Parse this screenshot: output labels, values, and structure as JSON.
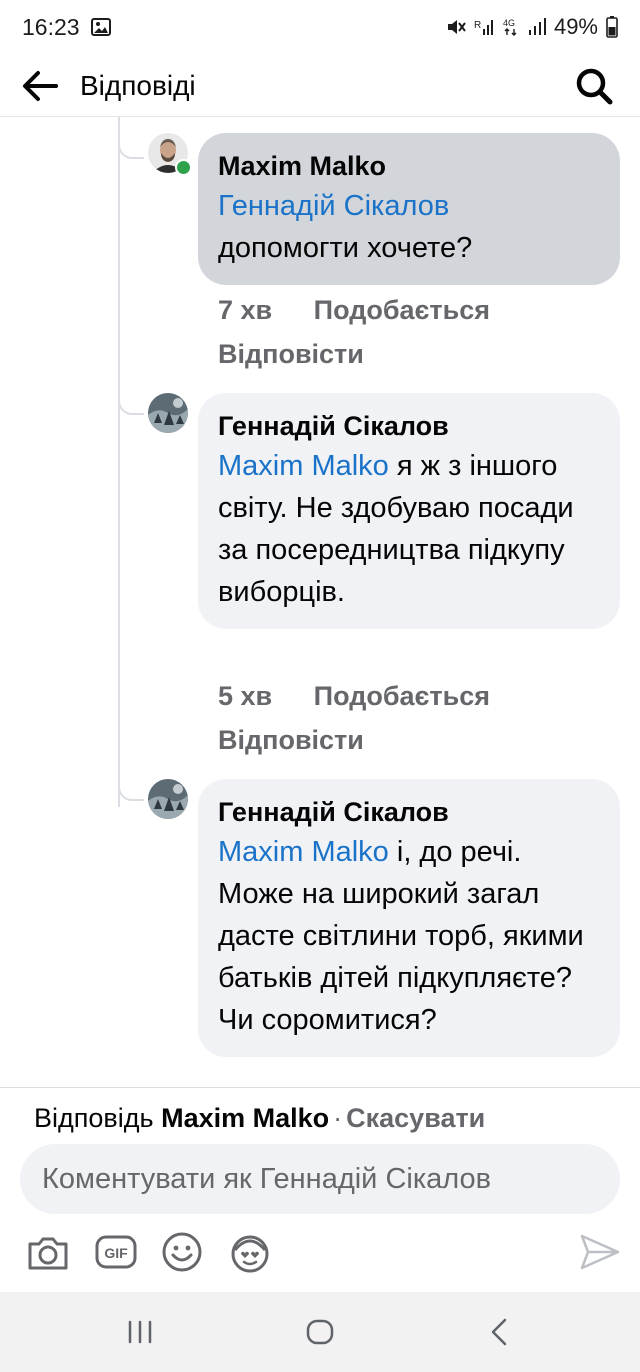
{
  "status_bar": {
    "time": "16:23",
    "battery": "49%"
  },
  "header": {
    "title": "Відповіді"
  },
  "comments": [
    {
      "author": "Maxim Malko",
      "mention": "Геннадій Сікалов",
      "text": "допомогти хочете?",
      "time": "7 хв",
      "like_label": "Подобається",
      "reply_label": "Відповісти",
      "online": true
    },
    {
      "author": "Геннадій Сікалов",
      "mention": "Maxim Malko",
      "text": " я ж з іншого світу. Не здобуваю посади за посередництва підкупу виборців.",
      "time": "5 хв",
      "like_label": "Подобається",
      "reply_label": "Відповісти"
    },
    {
      "author": "Геннадій Сікалов",
      "mention": "Maxim Malko",
      "text": " і, до речі. Може на широкий загал дасте світлини торб, якими батьків дітей підкупляєте? Чи соромитися?"
    }
  ],
  "reply_bar": {
    "replying_prefix": "Відповідь",
    "replying_to": "Maxim Malko",
    "separator": "·",
    "cancel_label": "Скасувати",
    "input_placeholder": "Коментувати як Геннадій Сікалов"
  },
  "toolbar": {
    "icons": [
      "camera-icon",
      "gif-icon",
      "emoji-icon",
      "avatar-sticker-icon",
      "send-icon"
    ],
    "gif_label": "GIF"
  },
  "colors": {
    "mention": "#1a73c8",
    "own_bubble": "#d2d5da",
    "other_bubble": "#f0f2f5",
    "meta_text": "#65676b",
    "online": "#31a24c"
  }
}
